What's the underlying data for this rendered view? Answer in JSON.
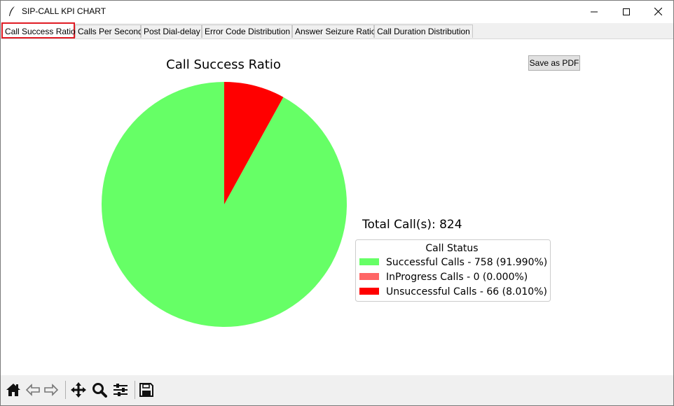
{
  "window": {
    "title": "SIP-CALL KPI CHART",
    "icons": [
      "feather-icon",
      "minimize-icon",
      "maximize-icon",
      "close-icon"
    ]
  },
  "tabs": [
    {
      "label": "Call Success Ratio",
      "active": true
    },
    {
      "label": "Calls Per Second",
      "active": false
    },
    {
      "label": "Post Dial-delay",
      "active": false
    },
    {
      "label": "Error Code Distribution",
      "active": false
    },
    {
      "label": "Answer Seizure Ratio",
      "active": false
    },
    {
      "label": "Call Duration Distribution",
      "active": false
    }
  ],
  "save_button": {
    "label": "Save as PDF"
  },
  "chart_data": {
    "type": "pie",
    "title": "Call Success Ratio",
    "total_label": "Total Call(s): 824",
    "legend_title": "Call Status",
    "legend_placement": "right",
    "slices": [
      {
        "label": "Successful Calls - 758 (91.990%)",
        "value": 758,
        "color": "#66ff66"
      },
      {
        "label": "InProgress Calls - 0 (0.000%)",
        "value": 0,
        "color": "#ff6666"
      },
      {
        "label": "Unsuccessful Calls - 66 (8.010%)",
        "value": 66,
        "color": "#ff0000"
      }
    ]
  },
  "toolbar": {
    "icons": [
      "home-icon",
      "back-icon",
      "forward-icon",
      "pan-icon",
      "zoom-icon",
      "configure-icon",
      "save-icon"
    ]
  }
}
